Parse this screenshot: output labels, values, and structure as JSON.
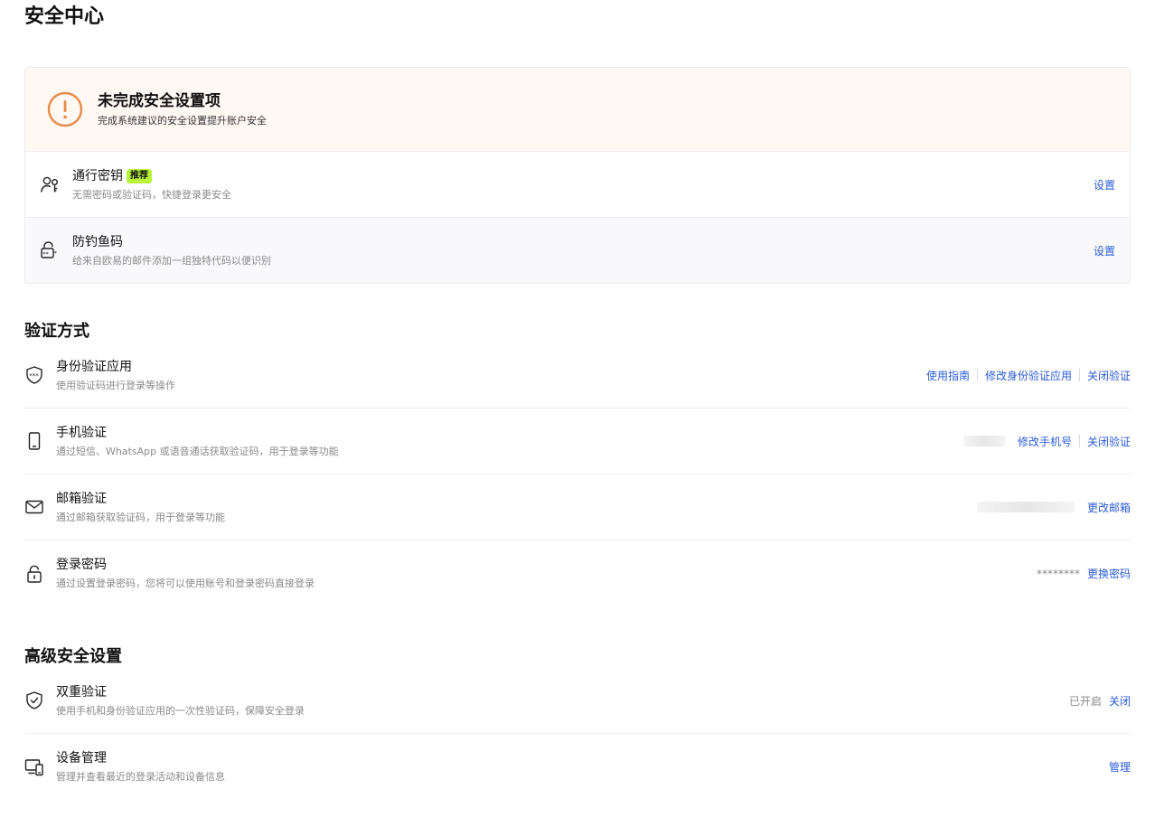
{
  "page": {
    "title": "安全中心"
  },
  "warning": {
    "title": "未完成安全设置项",
    "subtitle": "完成系统建议的安全设置提升账户安全",
    "items": [
      {
        "title": "通行密钥",
        "badge": "推荐",
        "subtitle": "无需密码或验证码，快捷登录更安全",
        "action": "设置",
        "icon": "passkey-icon"
      },
      {
        "title": "防钓鱼码",
        "subtitle": "给来自欧易的邮件添加一组独特代码以便识别",
        "action": "设置",
        "icon": "anti-phishing-icon"
      }
    ]
  },
  "verification": {
    "title": "验证方式",
    "authenticator": {
      "title": "身份验证应用",
      "subtitle": "使用验证码进行登录等操作",
      "guide": "使用指南",
      "modify": "修改身份验证应用",
      "disable": "关闭验证"
    },
    "phone": {
      "title": "手机验证",
      "subtitle": "通过短信、WhatsApp 或语音通话获取验证码，用于登录等功能",
      "modify": "修改手机号",
      "disable": "关闭验证"
    },
    "email": {
      "title": "邮箱验证",
      "subtitle": "通过邮箱获取验证码，用于登录等功能",
      "modify": "更改邮箱"
    },
    "password": {
      "title": "登录密码",
      "subtitle": "通过设置登录密码，您将可以使用账号和登录密码直接登录",
      "masked": "********",
      "change": "更换密码"
    }
  },
  "advanced": {
    "title": "高级安全设置",
    "two_factor": {
      "title": "双重验证",
      "subtitle": "使用手机和身份验证应用的一次性验证码，保障安全登录",
      "status": "已开启",
      "action": "关闭"
    },
    "devices": {
      "title": "设备管理",
      "subtitle": "管理并查看最近的登录活动和设备信息",
      "action": "管理"
    }
  },
  "colors": {
    "accent_link": "#2a5bd7",
    "warning_orange": "#e88a4a",
    "badge_green": "#b8f53a",
    "warning_bg": "#fff8f3"
  }
}
